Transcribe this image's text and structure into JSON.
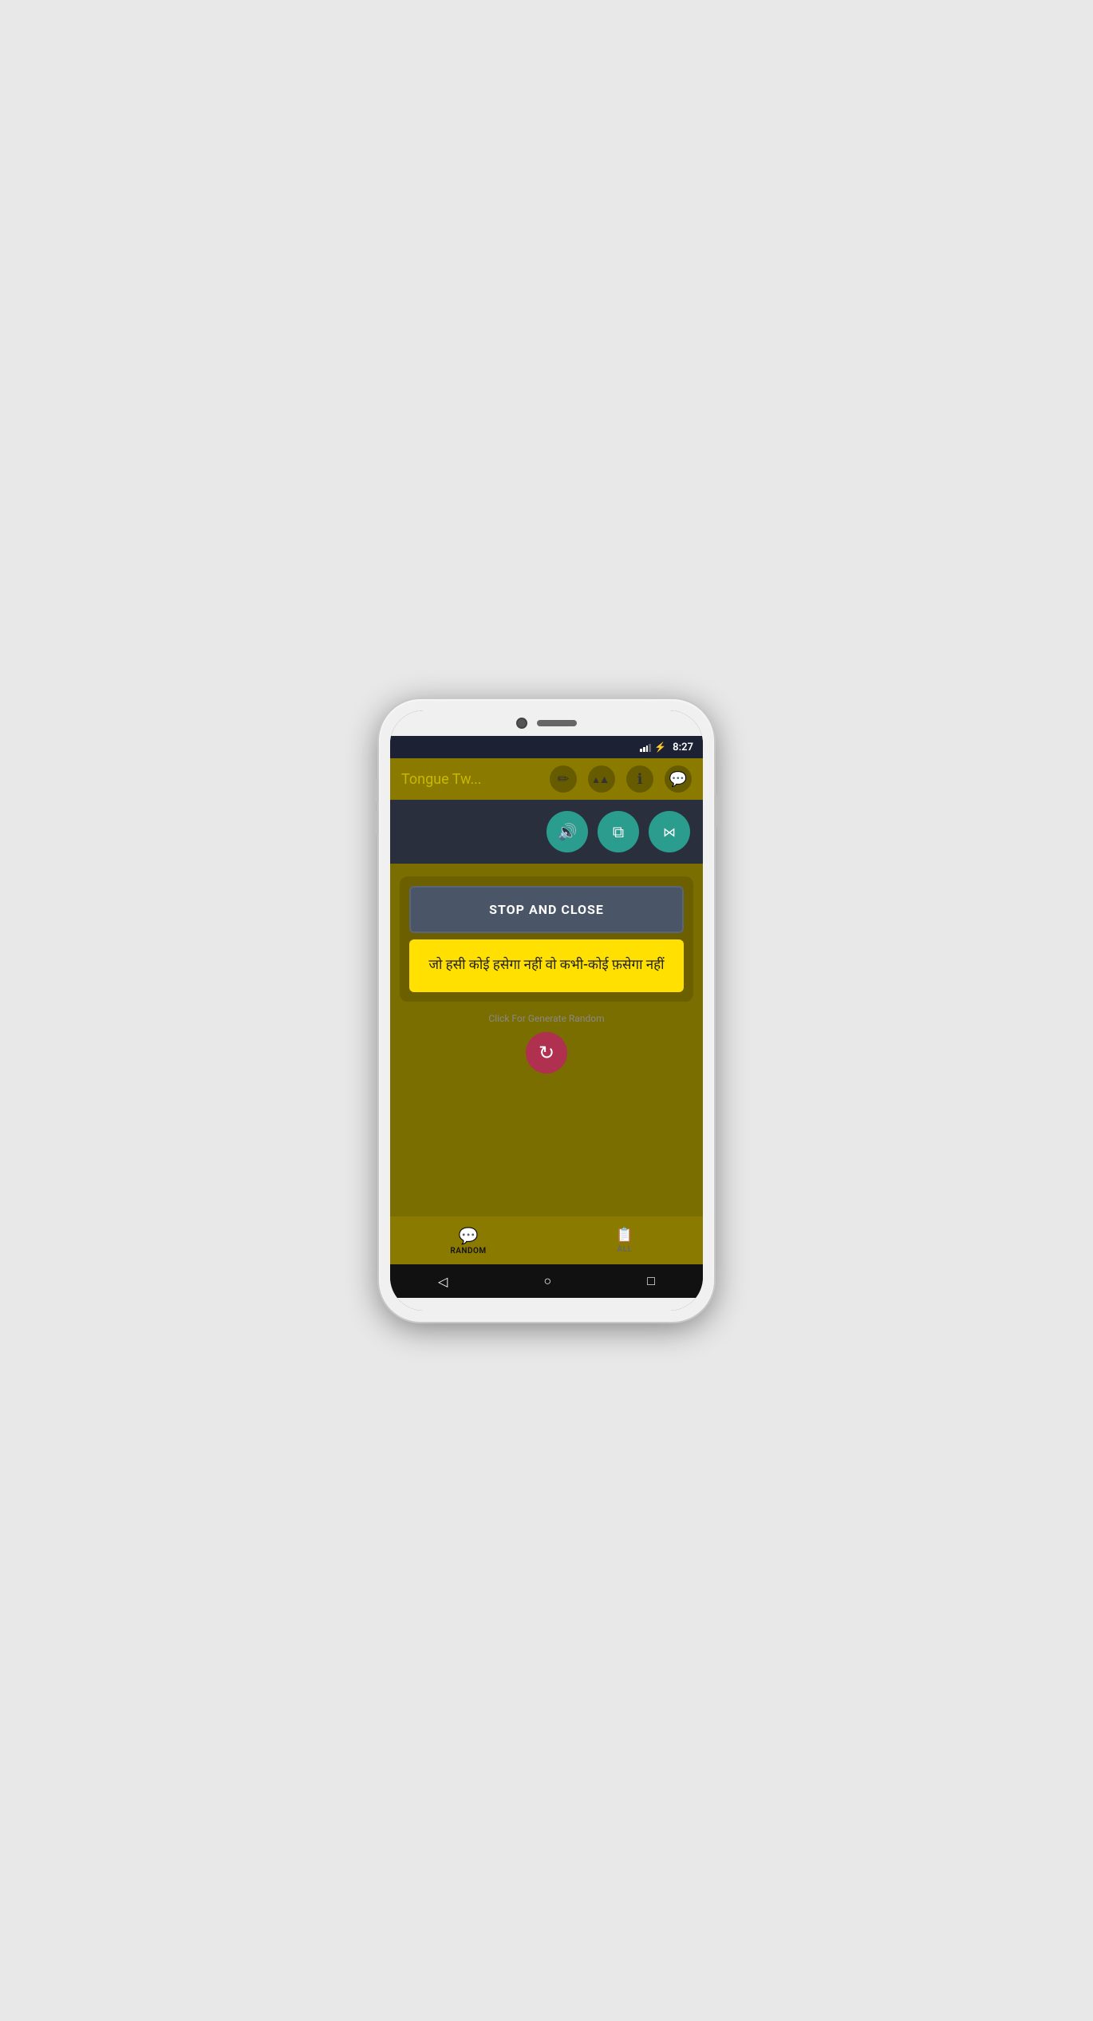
{
  "phone": {
    "status_bar": {
      "time": "8:27"
    },
    "app_bar": {
      "title": "Tongue Tw...",
      "icons": {
        "edit": "✏",
        "share": "⋮",
        "info": "ℹ",
        "chat": "💬"
      }
    },
    "action_buttons": {
      "speak": "speak-icon",
      "copy": "copy-icon",
      "share": "share-icon"
    },
    "main": {
      "stop_close_label": "STOP AND CLOSE",
      "tongue_twister": "जो हसी कोई हसेगा नहीं वो कभी-कोई फ़सेगा नहीं",
      "generate_hint": "Click For Generate Random",
      "refresh_icon": "↻"
    },
    "bottom_nav": {
      "items": [
        {
          "id": "random",
          "label": "RANDOM",
          "icon": "💬",
          "active": true
        },
        {
          "id": "all",
          "label": "ALL",
          "icon": "📋",
          "active": false
        }
      ]
    },
    "sys_nav": {
      "back": "◁",
      "home": "○",
      "recents": "□"
    }
  }
}
